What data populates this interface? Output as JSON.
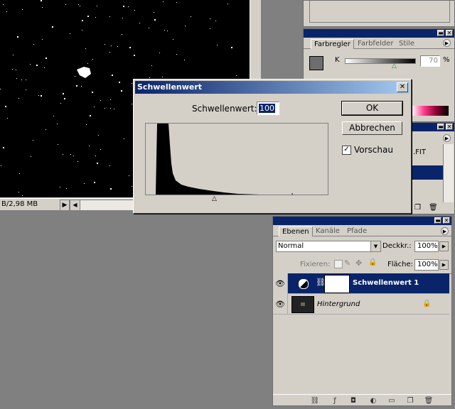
{
  "document": {
    "status": "B/2,98 MB"
  },
  "color_panel": {
    "tabs": [
      "Farbregler",
      "Farbfelder",
      "Stile"
    ],
    "channel_label": "K",
    "channel_value": "70",
    "percent": "%",
    "accent": "#0a246a"
  },
  "history_panel": {
    "text": ".FIT"
  },
  "dialog": {
    "title": "Schwellenwert",
    "threshold_label": "Schwellenwert:",
    "threshold_value": "100",
    "ok_label": "OK",
    "cancel_label": "Abbrechen",
    "preview_label": "Vorschau",
    "preview_checked": true,
    "close_glyph": "✕"
  },
  "layers_panel": {
    "tabs": [
      "Ebenen",
      "Kanäle",
      "Pfade"
    ],
    "blend_mode": "Normal",
    "opacity_label": "Deckkr.:",
    "opacity_value": "100%",
    "lock_label": "Fixieren:",
    "fill_label": "Fläche:",
    "fill_value": "100%",
    "layers": [
      {
        "name": "Schwellenwert 1",
        "selected": true
      },
      {
        "name": "Hintergrund",
        "selected": false
      }
    ]
  }
}
